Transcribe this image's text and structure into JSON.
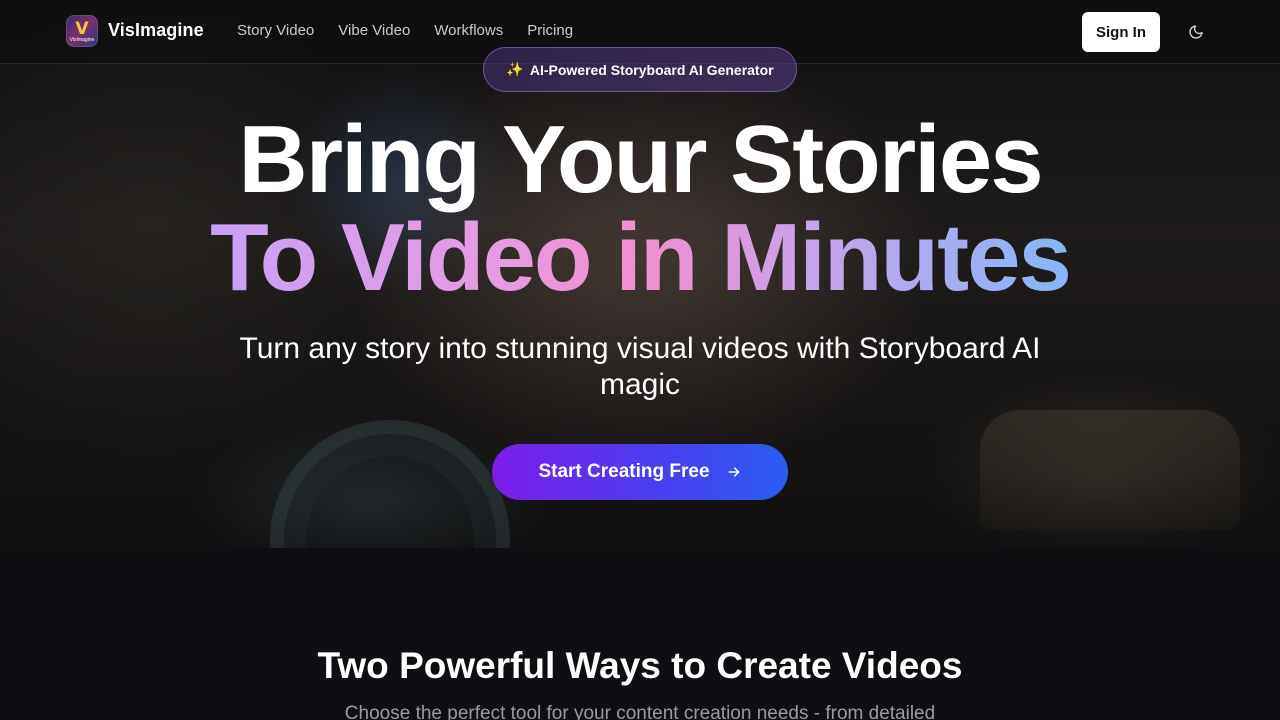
{
  "brand": {
    "name": "VisImagine",
    "logo_text": "VisImagine",
    "logo_mark": "V",
    "logo_icon": "visimagine-logo"
  },
  "nav": {
    "links": [
      "Story Video",
      "Vibe Video",
      "Workflows",
      "Pricing"
    ],
    "sign_in": "Sign In",
    "theme_icon": "moon-icon"
  },
  "hero": {
    "badge_icon": "✨",
    "badge_text": "AI-Powered Storyboard AI Generator",
    "headline_line1": "Bring Your Stories",
    "headline_line2": "To Video in Minutes",
    "subheadline": "Turn any story into stunning visual videos with Storyboard AI magic",
    "cta_label": "Start Creating Free",
    "cta_icon": "arrow-right-icon"
  },
  "features": {
    "title": "Two Powerful Ways to Create Videos",
    "description": "Choose the perfect tool for your content creation needs - from detailed"
  },
  "colors": {
    "background": "#0e0e12",
    "accent_purple": "#7c1de8",
    "accent_blue": "#2a5cf0",
    "gradient_pink": "#f08fcf",
    "gradient_lavender": "#c9a0f5",
    "gradient_sky": "#86b6f8"
  }
}
